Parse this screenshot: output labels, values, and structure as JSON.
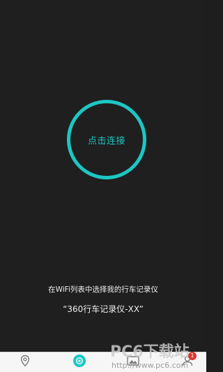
{
  "connect": {
    "label": "点击连接",
    "ring_color": "#1cc7c3"
  },
  "hint": {
    "line1": "在WiFi列表中选择我的行车记录仪",
    "line2": "“360行车记录仪-XX”"
  },
  "tabbar": {
    "items": [
      {
        "icon": "location-pin-icon"
      },
      {
        "icon": "record-icon",
        "active": true
      },
      {
        "icon": "album-icon"
      },
      {
        "icon": "profile-icon",
        "badge": "1"
      }
    ]
  },
  "watermark": {
    "brand": "PC6下载站",
    "url": "http://www.pc6.com"
  }
}
